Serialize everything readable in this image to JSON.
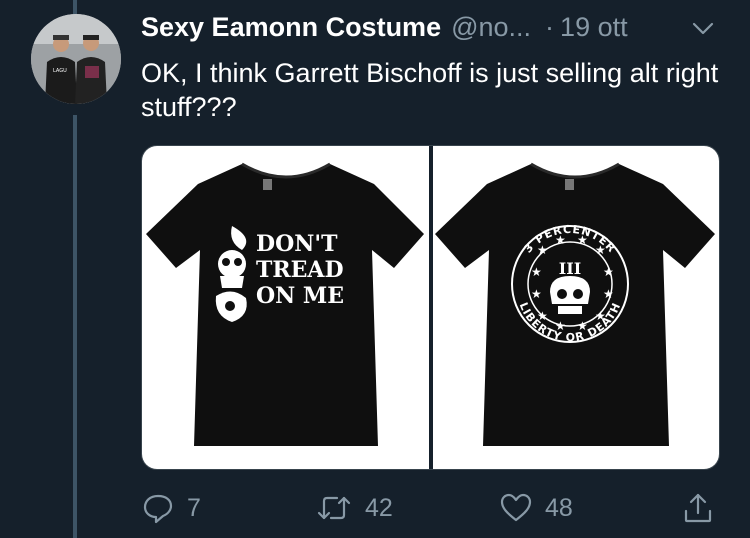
{
  "tweet": {
    "display_name": "Sexy Eamonn Costume",
    "handle": "@no...",
    "separator": "·",
    "timestamp": "19 ott",
    "text": "OK, I think Garrett Bischoff is just selling alt right stuff???",
    "avatar_shirt_text": "LAGU"
  },
  "media": {
    "left": {
      "line1": "DON'T",
      "line2": "TREAD",
      "line3": "ON ME"
    },
    "right": {
      "arc_top": "3 PERCENTER",
      "roman": "III",
      "arc_bottom": "LIBERTY OR DEATH"
    }
  },
  "actions": {
    "reply_count": "7",
    "retweet_count": "42",
    "like_count": "48"
  },
  "colors": {
    "background": "#15202b",
    "secondary_text": "#8899a6",
    "thread_line": "#3d5466"
  }
}
